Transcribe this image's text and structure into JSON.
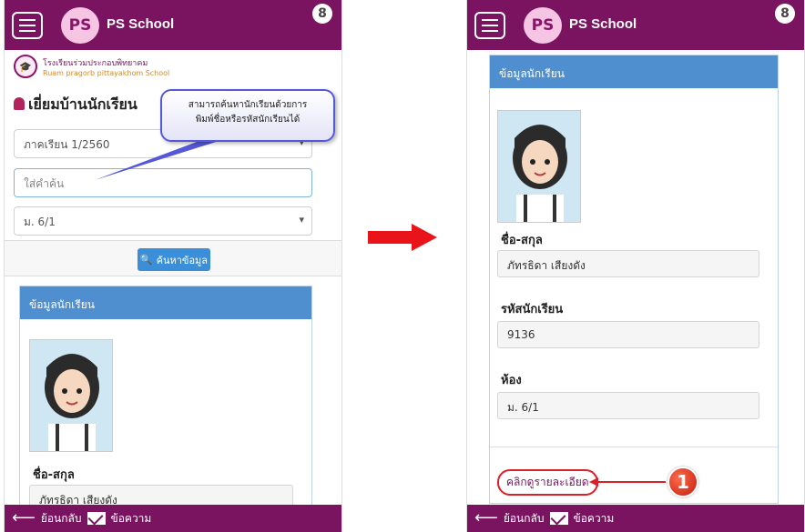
{
  "app": {
    "title": "PS School",
    "logo_text": "PS"
  },
  "school": {
    "name_th": "โรงเรียนร่วมประกอบพิทยาคม",
    "name_en": "Ruam pragorb pittayakhom School"
  },
  "left_screen": {
    "page_title": "เยี่ยมบ้านนักเรียน",
    "term_select": "ภาคเรียน 1/2560",
    "search_placeholder": "ใส่คำค้น",
    "class_select": "ม. 6/1",
    "search_button": "ค้นหาข้อมูล",
    "card_header": "ข้อมูลนักเรียน",
    "name_label": "ชื่อ-สกุล",
    "name_value": "ภัทรธิดา เสียงดัง"
  },
  "callout": {
    "line1": "สามารถค้นหานักเรียนด้วยการ",
    "line2": "พิมพ์ชื่อหรือรหัสนักเรียนได้"
  },
  "right_screen": {
    "card_header": "ข้อมูลนักเรียน",
    "name_label": "ชื่อ-สกุล",
    "name_value": "ภัทรธิดา เสียงดัง",
    "id_label": "รหัสนักเรียน",
    "id_value": "9136",
    "room_label": "ห้อง",
    "room_value": "ม. 6/1",
    "detail_link": "คลิกดูรายละเอียด",
    "step_number": "1"
  },
  "bottom_bar": {
    "back_label": "ย้อนกลับ",
    "message_label": "ข้อความ"
  },
  "colors": {
    "appbar": "#7a1460",
    "card_header": "#4f8fcf",
    "search_button": "#3a8fd8",
    "highlight": "#d9212a"
  }
}
